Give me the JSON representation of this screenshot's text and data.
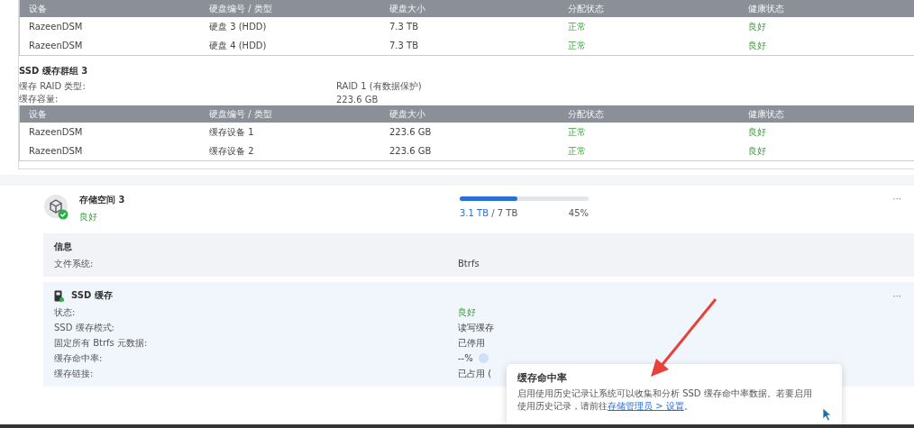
{
  "disk_table": {
    "columns": [
      "设备",
      "硬盘编号 / 类型",
      "硬盘大小",
      "分配状态",
      "健康状态"
    ],
    "rows": [
      {
        "device": "RazeenDSM",
        "drive": "硬盘 3 (HDD)",
        "size": "7.3 TB",
        "allocation": "正常",
        "health": "良好"
      },
      {
        "device": "RazeenDSM",
        "drive": "硬盘 4 (HDD)",
        "size": "7.3 TB",
        "allocation": "正常",
        "health": "良好"
      }
    ]
  },
  "cache_group": {
    "title": "SSD 缓存群组 3",
    "fields": [
      {
        "label": "缓存 RAID 类型:",
        "value": "RAID 1 (有数据保护)"
      },
      {
        "label": "缓存容量:",
        "value": "223.6 GB"
      }
    ]
  },
  "cache_table": {
    "columns": [
      "设备",
      "硬盘编号 / 类型",
      "硬盘大小",
      "分配状态",
      "健康状态"
    ],
    "rows": [
      {
        "device": "RazeenDSM",
        "drive": "缓存设备 1",
        "size": "223.6 GB",
        "allocation": "正常",
        "health": "良好"
      },
      {
        "device": "RazeenDSM",
        "drive": "缓存设备 2",
        "size": "223.6 GB",
        "allocation": "正常",
        "health": "良好"
      }
    ]
  },
  "volume": {
    "title": "存储空间 3",
    "status": "良好",
    "used": "3.1 TB",
    "total": "/ 7 TB",
    "percent": "45%",
    "level": 0.45,
    "more": "···"
  },
  "info": {
    "title": "信息",
    "fields": [
      {
        "label": "文件系统:",
        "value": "Btrfs"
      }
    ]
  },
  "ssd_cache": {
    "title": "SSD 缓存",
    "more": "···",
    "fields": [
      {
        "label": "状态:",
        "value": "良好",
        "kind": "status"
      },
      {
        "label": "SSD 缓存模式:",
        "value": "读写缓存",
        "kind": "plain"
      },
      {
        "label": "固定所有 Btrfs 元数据:",
        "value": "已停用",
        "kind": "plain"
      },
      {
        "label": "缓存命中率:",
        "value": "--%",
        "kind": "info"
      },
      {
        "label": "缓存链接:",
        "value": "已占用 (",
        "kind": "plain"
      }
    ]
  },
  "tooltip": {
    "title": "缓存命中率",
    "text": "启用使用历史记录让系统可以收集和分析 SSD 缓存命中率数据。若要启用使用历史记录，请前往",
    "link": "存储管理员 > 设置",
    "end": "。"
  }
}
